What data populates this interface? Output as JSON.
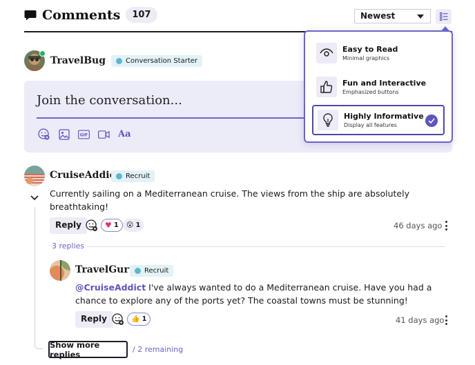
{
  "header": {
    "title": "Comments",
    "count": "107",
    "sort": {
      "selected": "Newest"
    }
  },
  "current_user": {
    "name": "TravelBug",
    "badge": "Conversation Starter"
  },
  "composer": {
    "placeholder": "Join the conversation...",
    "tools": [
      "emoji-icon",
      "image-icon",
      "gif-icon",
      "video-icon",
      "text-format-icon"
    ],
    "text_format_label": "Aa",
    "gif_label": "GIF"
  },
  "comments": [
    {
      "author": "CruiseAddict",
      "badge": "Recruit",
      "body": "Currently sailing on a Mediterranean cruise. The views from the ship are absolutely breathtaking!",
      "reply_label": "Reply",
      "reactions": [
        {
          "emoji": "♥",
          "count": "1"
        },
        {
          "emoji": "😮",
          "count": "1"
        }
      ],
      "timestamp": "46 days ago",
      "replies_count_label": "3 replies",
      "replies": [
        {
          "author": "TravelGuru",
          "badge": "Recruit",
          "mention": "@CruiseAddict",
          "body": " I've always wanted to do a Mediterranean cruise. Have you had a chance to explore any of the ports yet? The coastal towns must be stunning!",
          "reply_label": "Reply",
          "reactions": [
            {
              "emoji": "👍",
              "count": "1"
            }
          ],
          "timestamp": "41 days ago"
        }
      ]
    }
  ],
  "show_more": {
    "label": "Show more replies",
    "remaining": "/ 2 remaining"
  },
  "view_menu": {
    "options": [
      {
        "title": "Easy to Read",
        "subtitle": "Minimal graphics",
        "icon": "eye-icon",
        "selected": false
      },
      {
        "title": "Fun and Interactive",
        "subtitle": "Emphasized buttons",
        "icon": "thumbs-up-icon",
        "selected": false
      },
      {
        "title": "Highly Informative",
        "subtitle": "Display all features",
        "icon": "lightbulb-icon",
        "selected": true
      }
    ]
  },
  "colors": {
    "accent": "#5b55c0",
    "accent_light": "#ecebf6",
    "online": "#22b26a",
    "badge_bg": "#e2f2f6"
  }
}
